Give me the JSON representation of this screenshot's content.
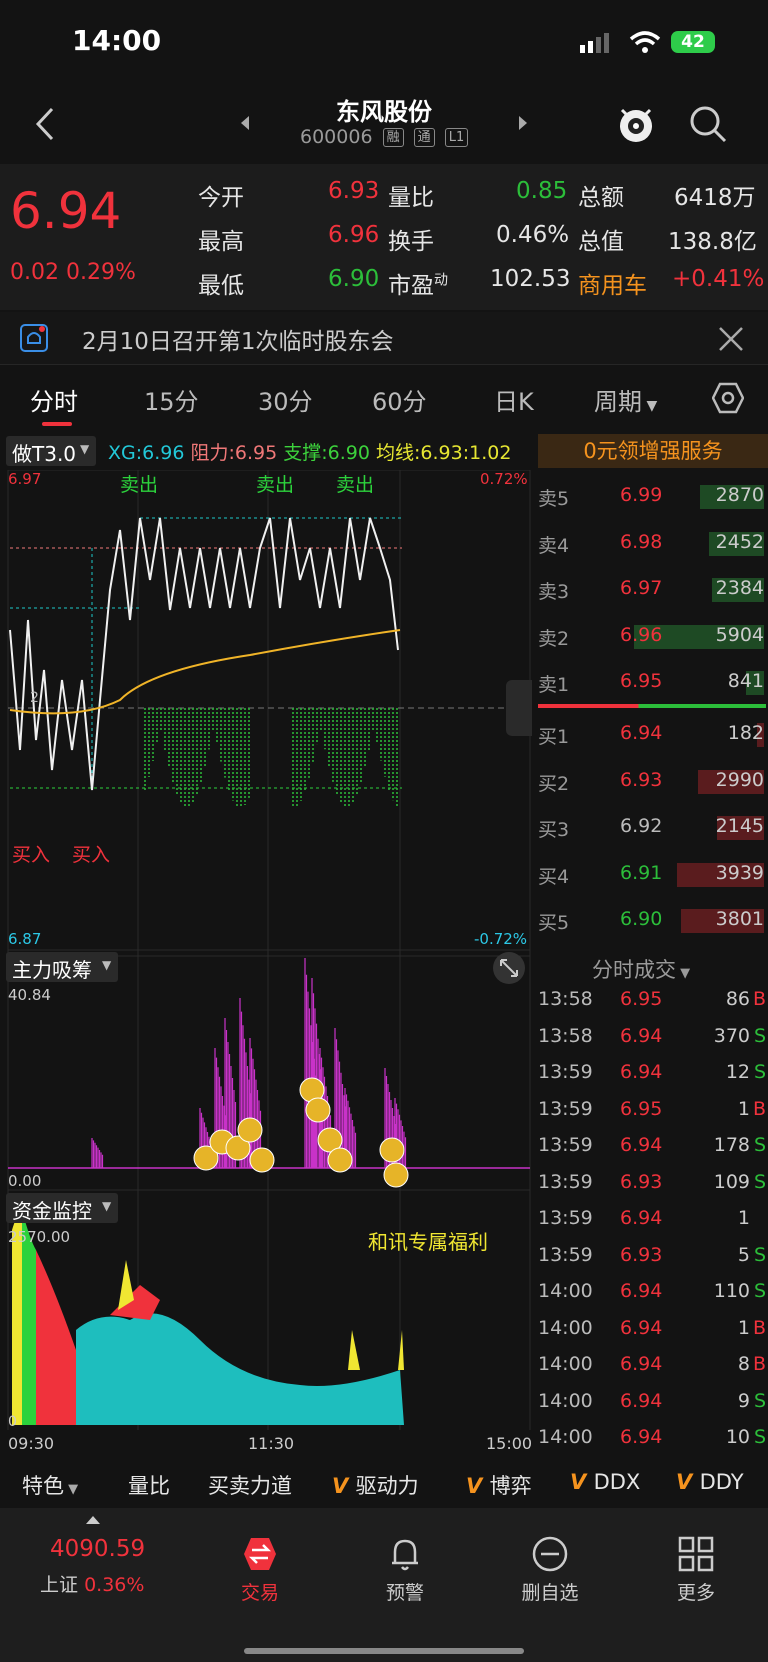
{
  "status_bar": {
    "time": "14:00",
    "battery": "42"
  },
  "nav": {
    "title": "东风股份",
    "code": "600006",
    "tags": [
      "融",
      "通",
      "L1"
    ]
  },
  "quote": {
    "price": "6.94",
    "change": "0.02",
    "change_pct": "0.29%",
    "rows": [
      {
        "l1": "今开",
        "v1": "6.93",
        "l2": "量比",
        "v2": "0.85",
        "l3": "总额",
        "v3": "6418万"
      },
      {
        "l1": "最高",
        "v1": "6.96",
        "l2": "换手",
        "v2": "0.46%",
        "l3": "总值",
        "v3": "138.8亿"
      },
      {
        "l1": "最低",
        "v1": "6.90",
        "l2": "市盈",
        "l2_sup": "动",
        "v2": "102.53",
        "l3": "商用车",
        "v3": "+0.41%"
      }
    ]
  },
  "notice": {
    "text": "2月10日召开第1次临时股东会"
  },
  "tabs": [
    "分时",
    "15分",
    "30分",
    "60分",
    "日K",
    "周期"
  ],
  "indicator_header": {
    "selector": "做T3.0",
    "xg": "XG:6.96",
    "resist": "阻力:6.95",
    "support": "支撑:6.90",
    "avg": "均线:6.93",
    "extra": ":1.02",
    "promo": "0元领增强服务"
  },
  "chart_labels": {
    "top_price": "6.97",
    "top_pct": "0.72%",
    "bottom_price": "6.87",
    "bottom_pct": "-0.72%",
    "sell_marks": [
      "卖出",
      "卖出",
      "卖出"
    ],
    "buy_marks": [
      "买入",
      "买入"
    ],
    "left_mid": "2"
  },
  "orderbook": {
    "sells": [
      {
        "label": "卖5",
        "price": "6.99",
        "vol": "2870",
        "ratio": 0.49
      },
      {
        "label": "卖4",
        "price": "6.98",
        "vol": "2452",
        "ratio": 0.42
      },
      {
        "label": "卖3",
        "price": "6.97",
        "vol": "2384",
        "ratio": 0.4
      },
      {
        "label": "卖2",
        "price": "6.96",
        "vol": "5904",
        "ratio": 1.0
      },
      {
        "label": "卖1",
        "price": "6.95",
        "vol": "841",
        "ratio": 0.14
      }
    ],
    "buys": [
      {
        "label": "买1",
        "price": "6.94",
        "vol": "182",
        "ratio": 0.05
      },
      {
        "label": "买2",
        "price": "6.93",
        "vol": "2990",
        "ratio": 0.51
      },
      {
        "label": "买3",
        "price": "6.92",
        "vol": "2145",
        "ratio": 0.36
      },
      {
        "label": "买4",
        "price": "6.91",
        "vol": "3939",
        "ratio": 0.67
      },
      {
        "label": "买5",
        "price": "6.90",
        "vol": "3801",
        "ratio": 0.64
      }
    ]
  },
  "ticks": {
    "header": "分时成交",
    "rows": [
      {
        "t": "13:58",
        "p": "6.95",
        "v": "86",
        "d": "B"
      },
      {
        "t": "13:58",
        "p": "6.94",
        "v": "370",
        "d": "S"
      },
      {
        "t": "13:59",
        "p": "6.94",
        "v": "12",
        "d": "S"
      },
      {
        "t": "13:59",
        "p": "6.95",
        "v": "1",
        "d": "B"
      },
      {
        "t": "13:59",
        "p": "6.94",
        "v": "178",
        "d": "S"
      },
      {
        "t": "13:59",
        "p": "6.93",
        "v": "109",
        "d": "S"
      },
      {
        "t": "13:59",
        "p": "6.94",
        "v": "1",
        "d": ""
      },
      {
        "t": "13:59",
        "p": "6.93",
        "v": "5",
        "d": "S"
      },
      {
        "t": "14:00",
        "p": "6.94",
        "v": "110",
        "d": "S"
      },
      {
        "t": "14:00",
        "p": "6.94",
        "v": "1",
        "d": "B"
      },
      {
        "t": "14:00",
        "p": "6.94",
        "v": "8",
        "d": "B"
      },
      {
        "t": "14:00",
        "p": "6.94",
        "v": "9",
        "d": "S"
      },
      {
        "t": "14:00",
        "p": "6.94",
        "v": "10",
        "d": "S"
      }
    ]
  },
  "panel2": {
    "selector": "主力吸筹",
    "max": "40.84",
    "min": "0.00"
  },
  "panel3": {
    "selector": "资金监控",
    "max": "2570.00",
    "min": "0",
    "promo": "和讯专属福利",
    "time_start": "09:30",
    "time_mid": "11:30",
    "time_end": "15:00"
  },
  "indicators": [
    "特色",
    "量比",
    "买卖力道",
    "驱动力",
    "博弈",
    "DDX",
    "DDY"
  ],
  "bottom_bar": {
    "index_value": "4090.59",
    "index_name": "上证",
    "index_pct": "0.36%",
    "items": [
      "交易",
      "预警",
      "删自选",
      "更多"
    ]
  },
  "colors": {
    "up": "#f0323c",
    "down": "#2cbe3a",
    "accent": "#f5931e",
    "magenta": "#c832c8",
    "cyan": "#1ec8c8"
  }
}
